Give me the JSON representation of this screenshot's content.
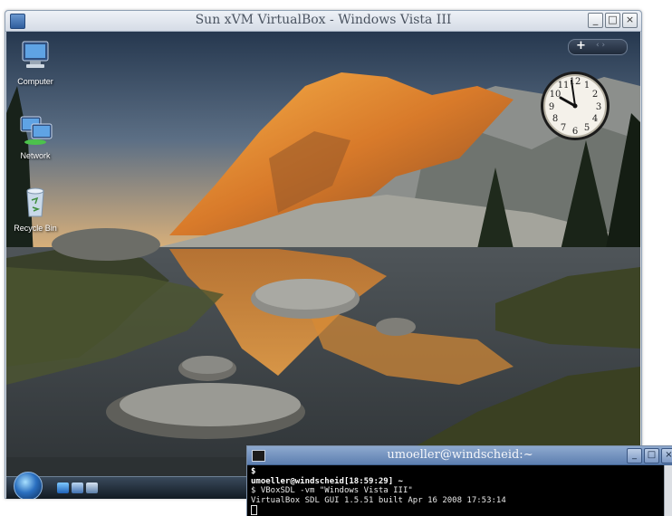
{
  "host_window": {
    "title": "Sun xVM VirtualBox - Windows Vista III",
    "icon": "virtualbox-app-icon",
    "controls": {
      "minimize": "_",
      "maximize": "□",
      "close": "×"
    }
  },
  "guest_desktop": {
    "icons": [
      {
        "label": "Computer",
        "icon": "computer-icon"
      },
      {
        "label": "Network",
        "icon": "network-icon"
      },
      {
        "label": "Recycle Bin",
        "icon": "recycle-bin-icon"
      }
    ],
    "sidebar": {
      "add_label": "+",
      "nav_label": "‹ ›"
    },
    "clock": {
      "hour_hand": "10",
      "minute_hand": "58"
    },
    "taskbar": {
      "start_icon": "windows-start-orb-icon",
      "quick_launch": [
        "internet-explorer-icon",
        "show-desktop-icon",
        "switch-windows-icon"
      ]
    }
  },
  "terminal": {
    "title": "umoeller@windscheid:~",
    "controls": {
      "minimize": "_",
      "maximize": "□",
      "close": "×"
    },
    "lines": [
      {
        "text": "$",
        "bold": true
      },
      {
        "text": "umoeller@windscheid[18:59:29] ~",
        "bold": true
      },
      {
        "text": "$ VBoxSDL -vm \"Windows Vista III\"",
        "bold": false
      },
      {
        "text": "VirtualBox SDL GUI 1.5.51 built Apr 16 2008 17:53:14",
        "bold": false
      }
    ]
  },
  "colors": {
    "host_title_text": "#4a5360",
    "terminal_title_bg": "#5d7fb0",
    "terminal_bg": "#000000",
    "terminal_fg": "#e8e8e8"
  }
}
